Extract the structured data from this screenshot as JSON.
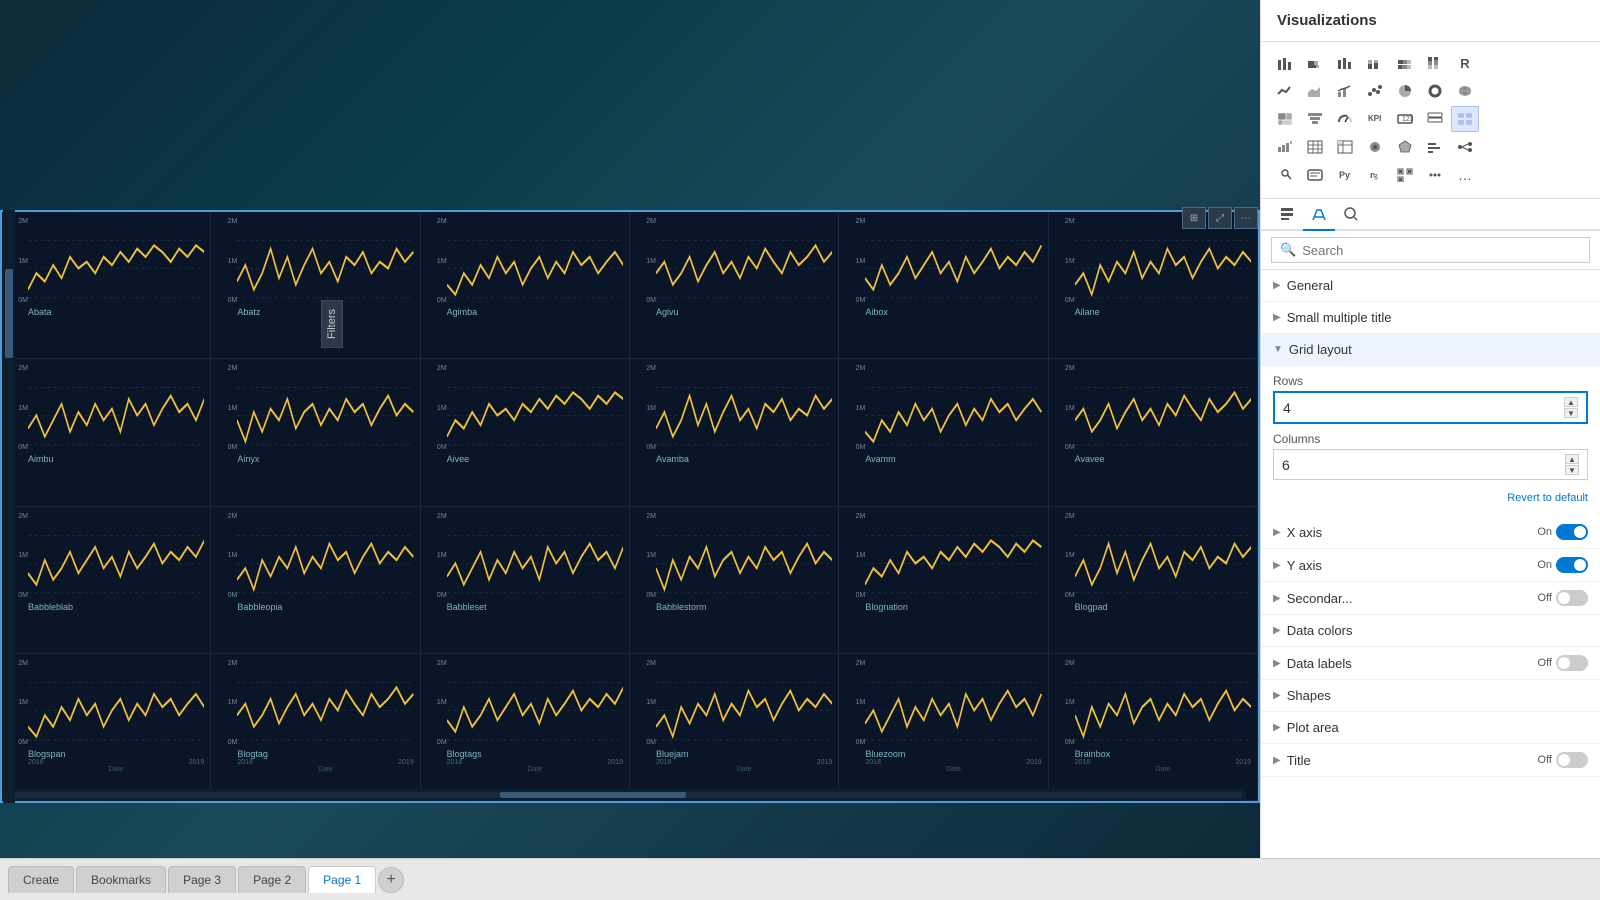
{
  "header": {
    "title": "Visualizations"
  },
  "viz_icons": [
    [
      "bar-chart",
      "stacked-bar",
      "column-chart",
      "stacked-column",
      "100pct-bar",
      "100pct-column",
      "R-icon"
    ],
    [
      "line-chart",
      "area-chart",
      "combo-chart",
      "scatter-chart",
      "pie-chart",
      "donut-chart",
      "filled-map"
    ],
    [
      "treemap",
      "funnel",
      "gauge",
      "kpi",
      "card",
      "multi-row-card",
      "ribbon-chart"
    ],
    [
      "waterfall",
      "table",
      "matrix",
      "azure-map",
      "shape-map",
      "slicer",
      "decomp-tree"
    ],
    [
      "key-influencer",
      "smart-narrative",
      "python-visual",
      "r-visual",
      "qr-code",
      "more-visuals",
      "ellipsis"
    ]
  ],
  "viz_tabs": [
    {
      "id": "fields",
      "icon": "⊞",
      "active": false
    },
    {
      "id": "format",
      "icon": "🖌",
      "active": true
    },
    {
      "id": "analytics",
      "icon": "🔍",
      "active": false
    }
  ],
  "search": {
    "placeholder": "Search",
    "value": ""
  },
  "format_sections": [
    {
      "id": "general",
      "label": "General",
      "expanded": false,
      "toggle": null
    },
    {
      "id": "small-multiple-title",
      "label": "Small multiple title",
      "expanded": false,
      "toggle": null
    },
    {
      "id": "grid-layout",
      "label": "Grid layout",
      "expanded": true,
      "toggle": null
    },
    {
      "id": "x-axis",
      "label": "X axis",
      "expanded": false,
      "toggle": "On"
    },
    {
      "id": "y-axis",
      "label": "Y axis",
      "expanded": false,
      "toggle": "On"
    },
    {
      "id": "secondary",
      "label": "Secondar...",
      "expanded": false,
      "toggle": "Off"
    },
    {
      "id": "data-colors",
      "label": "Data colors",
      "expanded": false,
      "toggle": null
    },
    {
      "id": "data-labels",
      "label": "Data labels",
      "expanded": false,
      "toggle": "Off"
    },
    {
      "id": "shapes",
      "label": "Shapes",
      "expanded": false,
      "toggle": null
    },
    {
      "id": "plot-area",
      "label": "Plot area",
      "expanded": false,
      "toggle": null
    },
    {
      "id": "title",
      "label": "Title",
      "expanded": false,
      "toggle": "Off"
    }
  ],
  "grid_layout": {
    "rows_label": "Rows",
    "rows_value": "4",
    "columns_label": "Columns",
    "columns_value": "6",
    "revert_label": "Revert to default"
  },
  "chart_cells": [
    {
      "title": "Abata",
      "row": 0,
      "col": 0
    },
    {
      "title": "Abatz",
      "row": 0,
      "col": 1
    },
    {
      "title": "Agimba",
      "row": 0,
      "col": 2
    },
    {
      "title": "Agivu",
      "row": 0,
      "col": 3
    },
    {
      "title": "Aibox",
      "row": 0,
      "col": 4
    },
    {
      "title": "Ailane",
      "row": 0,
      "col": 5
    },
    {
      "title": "Aimbu",
      "row": 1,
      "col": 0
    },
    {
      "title": "Ainyx",
      "row": 1,
      "col": 1
    },
    {
      "title": "Aivee",
      "row": 1,
      "col": 2
    },
    {
      "title": "Avamba",
      "row": 1,
      "col": 3
    },
    {
      "title": "Avamm",
      "row": 1,
      "col": 4
    },
    {
      "title": "Avavee",
      "row": 1,
      "col": 5
    },
    {
      "title": "Babbleblab",
      "row": 2,
      "col": 0
    },
    {
      "title": "Babbleopia",
      "row": 2,
      "col": 1
    },
    {
      "title": "Babbleset",
      "row": 2,
      "col": 2
    },
    {
      "title": "Babblestorm",
      "row": 2,
      "col": 3
    },
    {
      "title": "Blognation",
      "row": 2,
      "col": 4
    },
    {
      "title": "Blogpad",
      "row": 2,
      "col": 5
    },
    {
      "title": "Blogspan",
      "row": 3,
      "col": 0
    },
    {
      "title": "Blogtag",
      "row": 3,
      "col": 1
    },
    {
      "title": "Blogtags",
      "row": 3,
      "col": 2
    },
    {
      "title": "Bluejam",
      "row": 3,
      "col": 3
    },
    {
      "title": "Bluezoom",
      "row": 3,
      "col": 4
    },
    {
      "title": "Brainbox",
      "row": 3,
      "col": 5
    }
  ],
  "y_labels": [
    "2M",
    "1M",
    "0M"
  ],
  "x_labels": [
    "2018",
    "2019"
  ],
  "x_axis_label": "Date",
  "page_tabs": [
    {
      "label": "Create",
      "active": false
    },
    {
      "label": "Bookmarks",
      "active": false
    },
    {
      "label": "Page 3",
      "active": false
    },
    {
      "label": "Page 2",
      "active": false
    },
    {
      "label": "Page 1",
      "active": true
    }
  ],
  "filters_label": "Filters",
  "colors": {
    "chart_line": "#f0c040",
    "chart_bg": "#0a1628",
    "chart_border": "#4a9edd",
    "panel_bg": "#f0f0f0"
  }
}
